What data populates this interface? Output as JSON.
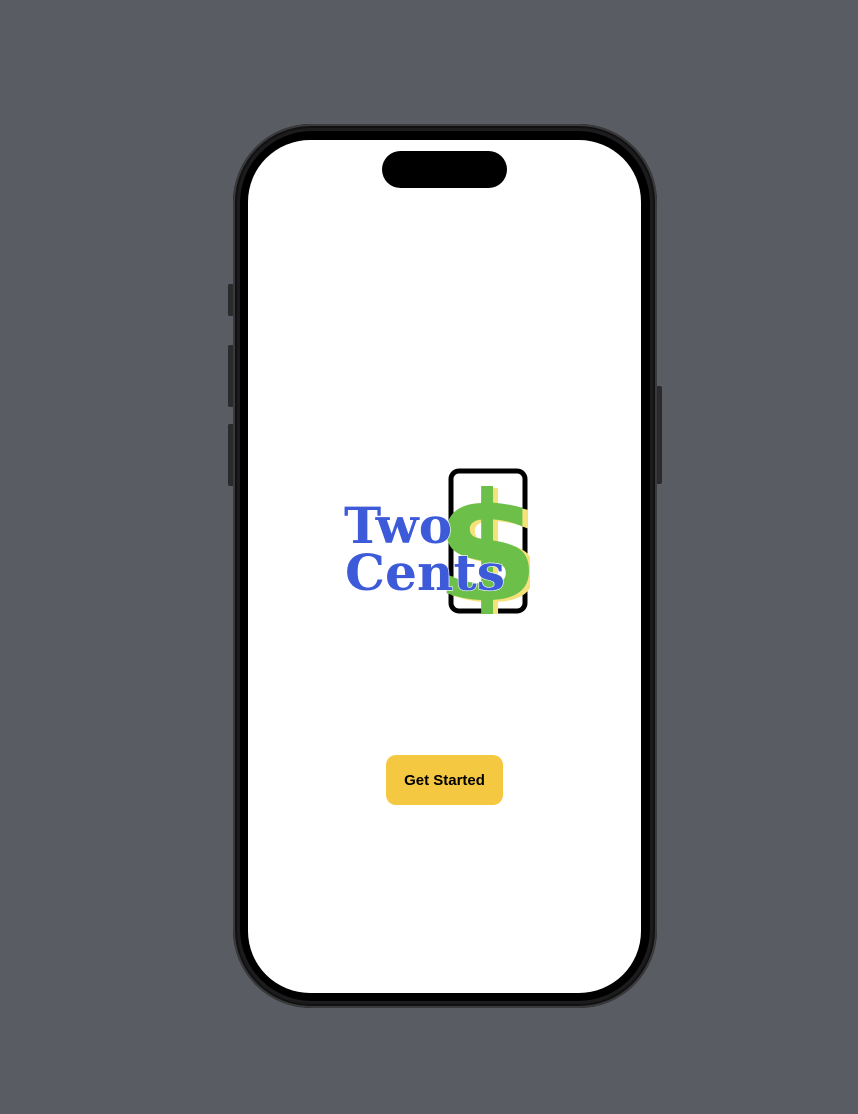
{
  "logo": {
    "line1": "Two",
    "line2": "Cents",
    "symbol": "$",
    "colors": {
      "text": "#3d5bd9",
      "dollar": "#6cc04a",
      "dollar_shadow": "#f5e27a",
      "card_border": "#000000"
    }
  },
  "cta": {
    "label": "Get Started",
    "color": "#f5c842"
  },
  "device": {
    "background": "#595d63",
    "screen": "#ffffff"
  }
}
